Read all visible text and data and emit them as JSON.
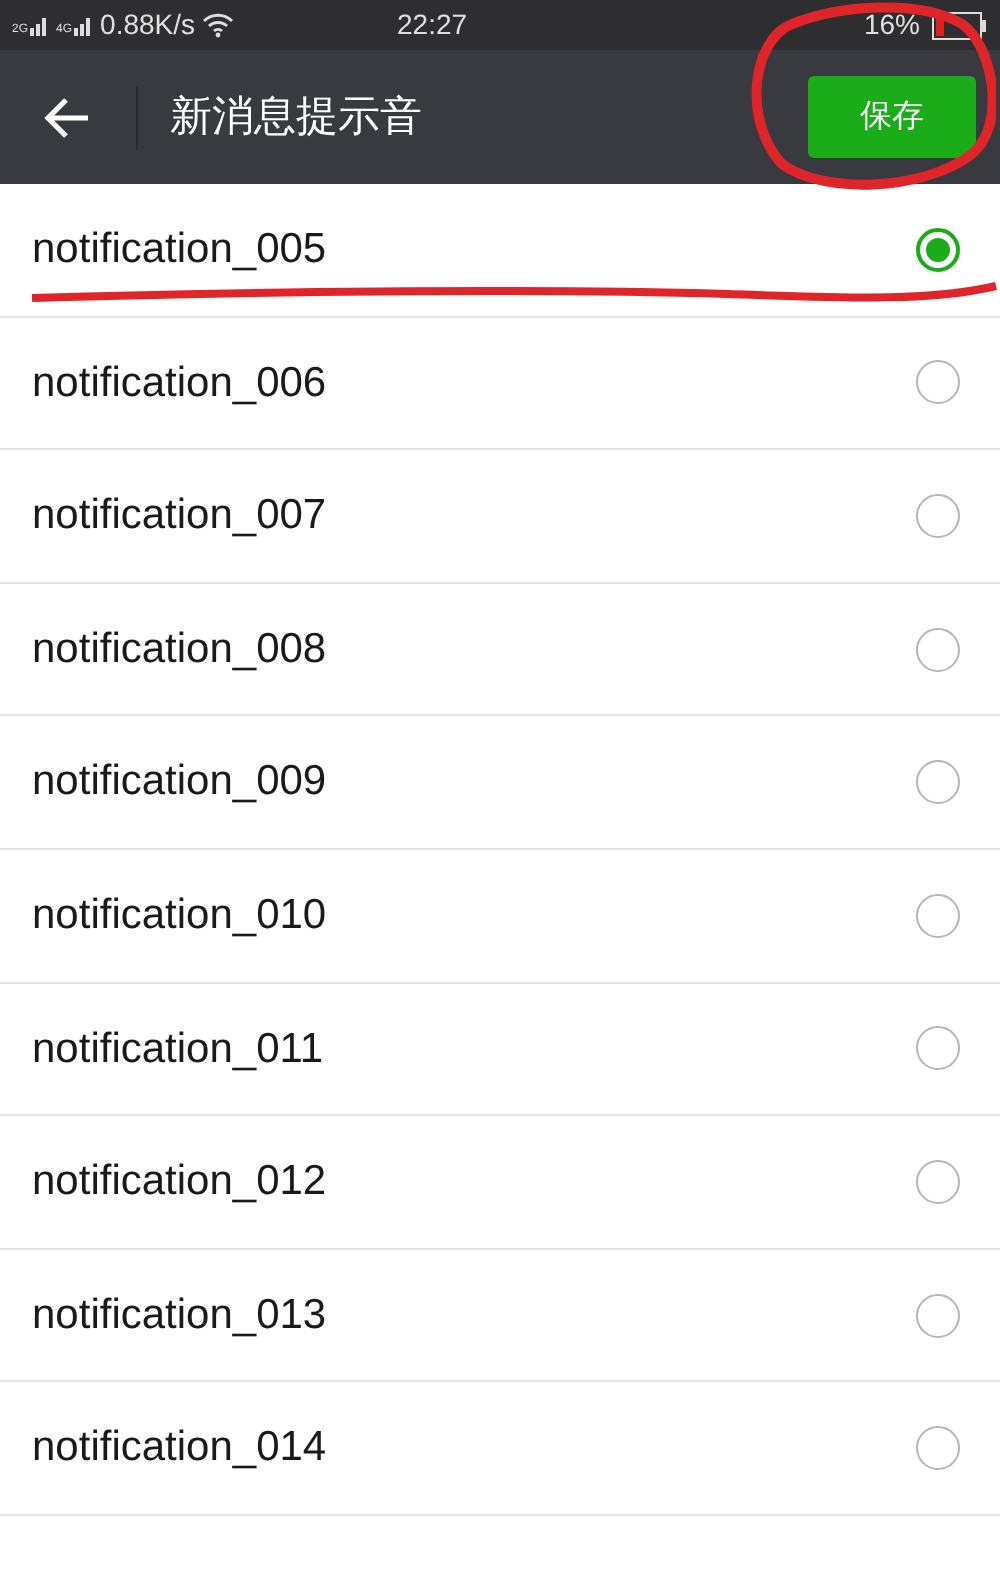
{
  "status_bar": {
    "network_1": "2G",
    "network_2": "4G",
    "speed": "0.88K/s",
    "time": "22:27",
    "battery": "16%"
  },
  "toolbar": {
    "title": "新消息提示音",
    "save_button": "保存"
  },
  "sounds": [
    {
      "label": "notification_005",
      "selected": true
    },
    {
      "label": "notification_006",
      "selected": false
    },
    {
      "label": "notification_007",
      "selected": false
    },
    {
      "label": "notification_008",
      "selected": false
    },
    {
      "label": "notification_009",
      "selected": false
    },
    {
      "label": "notification_010",
      "selected": false
    },
    {
      "label": "notification_011",
      "selected": false
    },
    {
      "label": "notification_012",
      "selected": false
    },
    {
      "label": "notification_013",
      "selected": false
    },
    {
      "label": "notification_014",
      "selected": false
    }
  ]
}
